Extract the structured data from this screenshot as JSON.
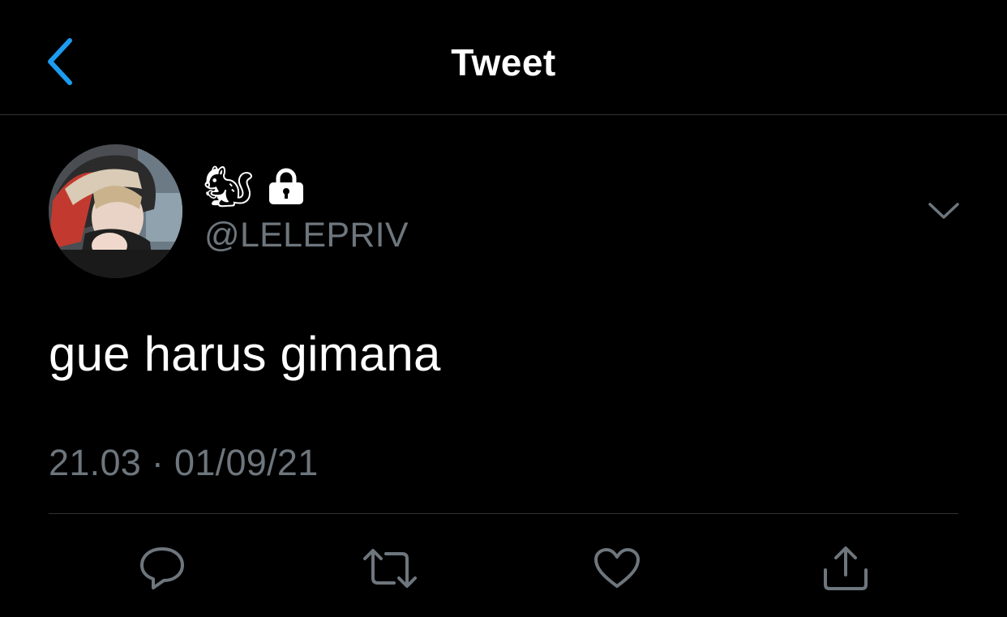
{
  "header": {
    "title": "Tweet"
  },
  "tweet": {
    "display_name": "🐿",
    "handle": "@LELEPRIV",
    "text": "gue harus gimana",
    "timestamp": "21.03 · 01/09/21"
  },
  "icons": {
    "back": "chevron-left-icon",
    "protected": "lock-icon",
    "more": "chevron-down-icon",
    "reply": "reply-icon",
    "retweet": "retweet-icon",
    "like": "heart-icon",
    "share": "share-icon"
  },
  "colors": {
    "background": "#000000",
    "accent": "#1d9bf0",
    "secondary_text": "#6e767d",
    "divider": "#2f3336"
  }
}
